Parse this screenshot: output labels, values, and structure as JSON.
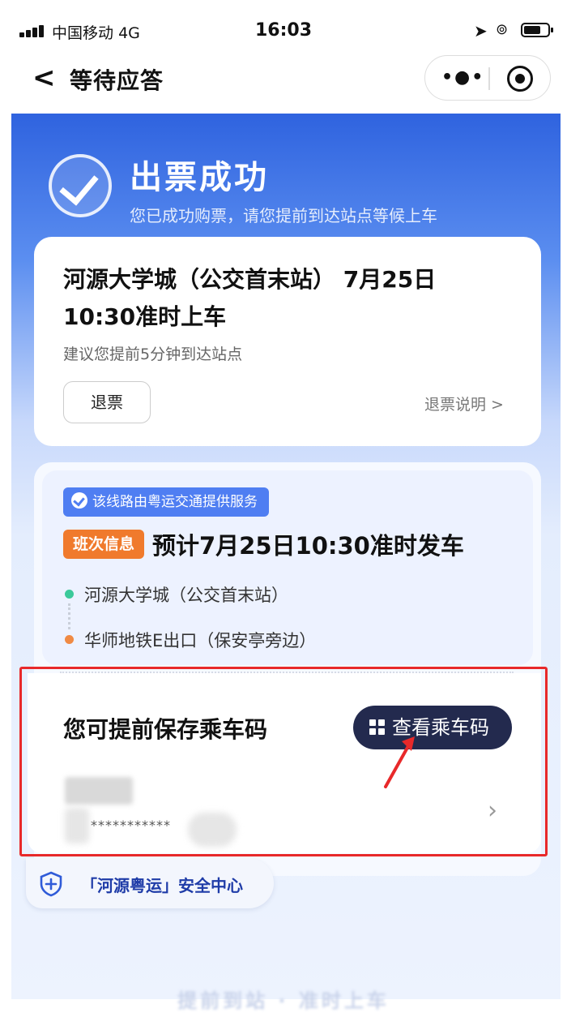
{
  "status_bar": {
    "carrier": "中国移动",
    "network": "4G",
    "time": "16:03"
  },
  "nav": {
    "title": "等待应答"
  },
  "hero": {
    "title": "出票成功",
    "subtitle": "您已成功购票，请您提前到达站点等候上车"
  },
  "ticket": {
    "route_line1": "河源大学城（公交首末站） 7月25日",
    "route_line2": "10:30准时上车",
    "hint": "建议您提前5分钟到达站点",
    "refund_button": "退票",
    "refund_link": "退票说明 >"
  },
  "schedule": {
    "provider": "该线路由粤运交通提供服务",
    "badge": "班次信息",
    "depart": "预计7月25日10:30准时发车",
    "stop_from": "河源大学城（公交首末站）",
    "stop_to": "华师地铁E出口（保安亭旁边）",
    "colors": {
      "from": "#3bc99a",
      "to": "#f08a44",
      "badge": "#f07a2c",
      "provider": "#4f7ef2"
    }
  },
  "boarding_code": {
    "title": "您可提前保存乘车码",
    "button": "查看乘车码",
    "masked": "***********"
  },
  "safety": {
    "label": "「河源粤运」安全中心"
  },
  "bottom_ghost": "提前到站 · 准时上车",
  "colors": {
    "primary": "#2f63df",
    "highlight": "#e8292a",
    "dark_button": "#232a4e"
  },
  "icons": [
    "signal-icon",
    "location-icon",
    "alarm-icon",
    "battery-icon",
    "back-icon",
    "more-icon",
    "target-icon",
    "check-circle-icon",
    "grid-icon",
    "chevron-right-icon",
    "shield-plus-icon",
    "arrow-annotation"
  ]
}
